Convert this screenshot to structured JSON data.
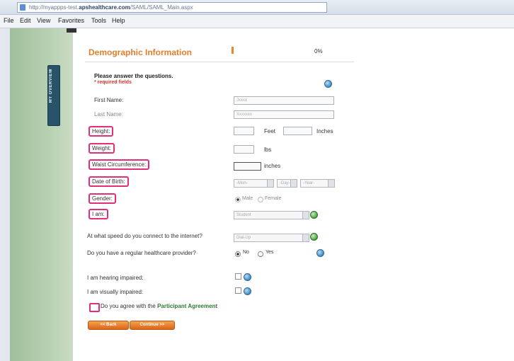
{
  "browser": {
    "url_prefix": "http://myappps-test.",
    "url_host": "apshealthcare.com",
    "url_path": "/SAML/SAML_Main.aspx",
    "menu": [
      "File",
      "Edit",
      "View",
      "Favorites",
      "Tools",
      "Help"
    ]
  },
  "sidebar": {
    "tab_label": "MY OVERVIEW"
  },
  "header": {
    "title": "Demographic Information",
    "progress_text": "0%",
    "progress_fraction": 0.0
  },
  "form": {
    "instructions": "Please answer the questions.",
    "required_note": "* required fields",
    "first_name_label": "First Name:",
    "first_name_value": "Jxxxx",
    "last_name_label": "Last Name:",
    "last_name_value": "Xxxxxxx",
    "height_label": "Height:",
    "feet_label": "Feet",
    "inches_label": "Inches",
    "weight_label": "Weight:",
    "lbs_label": "lbs",
    "waist_label": "Waist Circumference:",
    "waist_unit": "inches",
    "dob_label": "Date of Birth:",
    "dob_month": "-Mon-",
    "dob_day": "-Day-",
    "dob_year": "-Year-",
    "gender_label": "Gender:",
    "gender_male": "Male",
    "gender_female": "Female",
    "i_am_label": "I am:",
    "i_am_value": "Student",
    "speed_label": "At what speed do you connect to the internet?",
    "speed_value": "Dial-Up",
    "provider_label": "Do you have a regular healthcare provider?",
    "provider_no": "No",
    "provider_yes": "Yes",
    "hearing_label": "I am hearing impaired:",
    "visual_label": "I am visually impaired:",
    "agree_prefix": "Do you agree with the",
    "agree_link": "Participant Agreement",
    "back_button": "<< Back",
    "continue_button": "Continue >>"
  },
  "colors": {
    "accent": "#e17f2d",
    "highlight": "#e12f7a",
    "link": "#2e7b2e"
  }
}
